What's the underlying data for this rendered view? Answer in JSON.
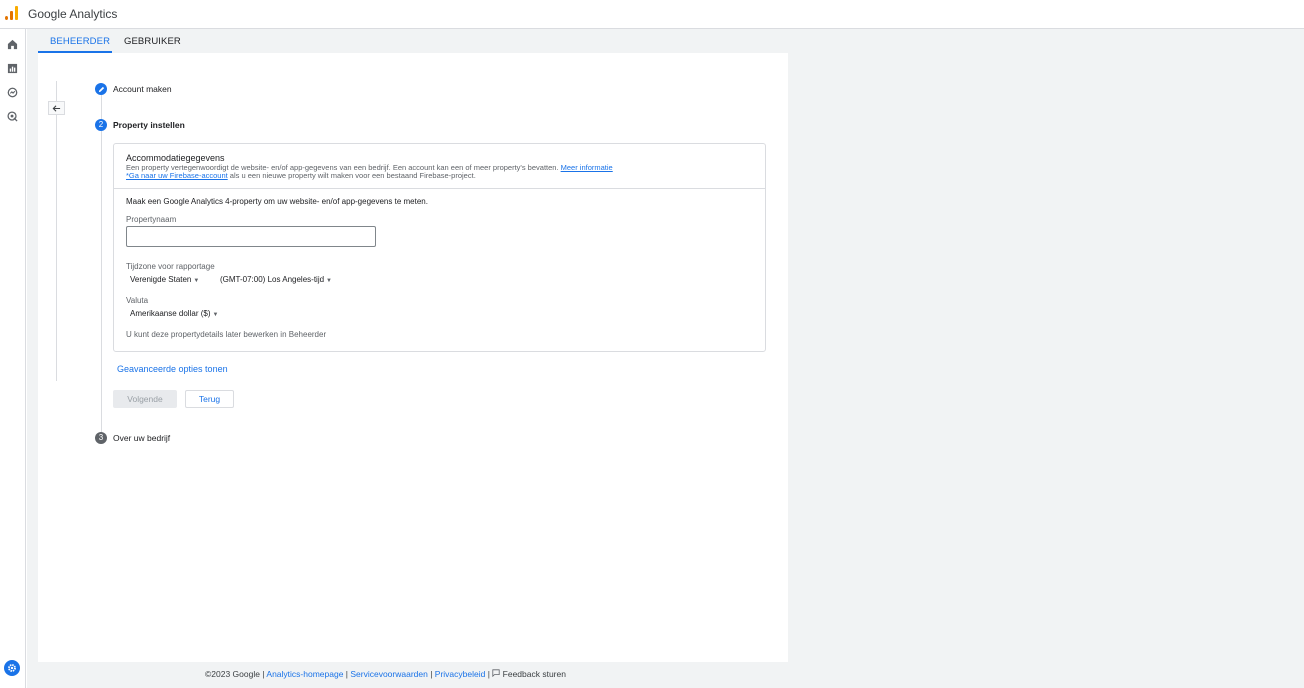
{
  "header": {
    "app_title": "Google Analytics",
    "logo_icon": "analytics-logo"
  },
  "sidebar": {
    "icons": [
      "home-icon",
      "reports-icon",
      "explore-icon",
      "advertising-icon"
    ],
    "settings_icon": "gear-icon"
  },
  "tabs": [
    {
      "label": "BEHEERDER",
      "active": true
    },
    {
      "label": "GEBRUIKER",
      "active": false
    }
  ],
  "stepper": {
    "back_icon": "arrow-left-icon",
    "steps": [
      {
        "number": "",
        "icon": "pencil-icon",
        "label": "Account maken",
        "state": "done"
      },
      {
        "number": "2",
        "label": "Property instellen",
        "state": "active"
      },
      {
        "number": "3",
        "label": "Over uw bedrijf",
        "state": "pending"
      }
    ]
  },
  "card": {
    "title": "Accommodatiegegevens",
    "desc_text": "Een property vertegenwoordigt de website- en/of app-gegevens van een bedrijf. Een account kan een of meer property's bevatten. ",
    "desc_link": "Meer informatie",
    "firebase_link": "*Ga naar uw Firebase-account",
    "firebase_text": " als u een nieuwe property wilt maken voor een bestaand Firebase-project.",
    "intro": "Maak een Google Analytics 4-property om uw website- en/of app-gegevens te meten.",
    "property_name_label": "Propertynaam",
    "property_name_value": "",
    "timezone_label": "Tijdzone voor rapportage",
    "country_value": "Verenigde Staten",
    "timezone_value": "(GMT-07:00) Los Angeles-tijd",
    "currency_label": "Valuta",
    "currency_value": "Amerikaanse dollar ($)",
    "note": "U kunt deze propertydetails later bewerken in Beheerder"
  },
  "actions": {
    "advanced_link": "Geavanceerde opties tonen",
    "next_label": "Volgende",
    "back_label": "Terug"
  },
  "footer": {
    "copyright": "©2023 Google | ",
    "links": [
      "Analytics-homepage",
      "Servicevoorwaarden",
      "Privacybeleid"
    ],
    "separator": " | ",
    "feedback": "Feedback sturen"
  },
  "colors": {
    "accent": "#1a73e8",
    "brand_orange": "#f9ab00",
    "border": "#dadce0"
  }
}
